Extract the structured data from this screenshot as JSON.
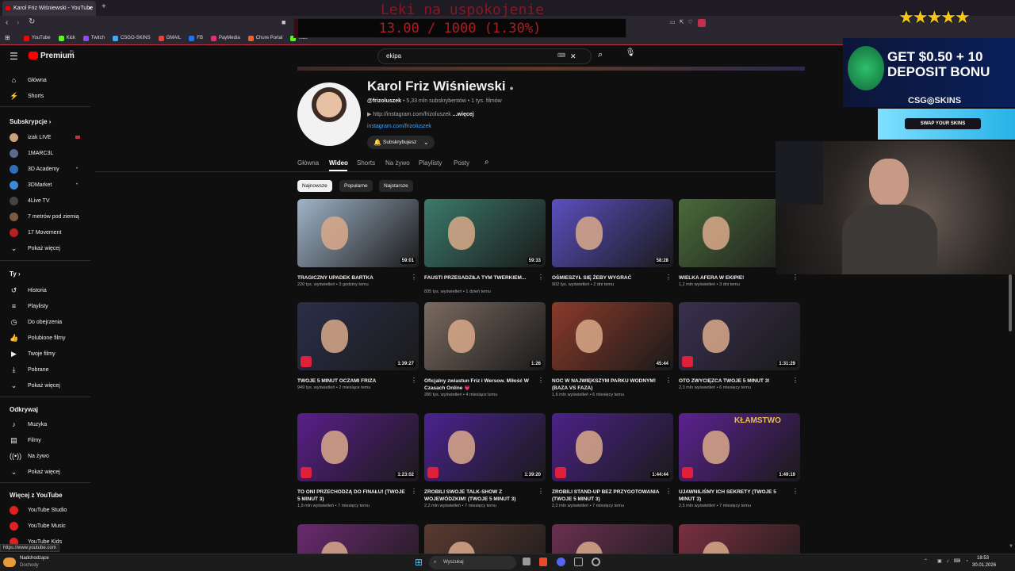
{
  "browser": {
    "tab_title": "Karol Friz Wiśniewski - YouTube",
    "new_tab": "+",
    "bookmarks": [
      {
        "label": "YouTube",
        "color": "#ff0000"
      },
      {
        "label": "Kick",
        "color": "#53fc18"
      },
      {
        "label": "Twitch",
        "color": "#9146ff"
      },
      {
        "label": "CSGO-SKINS",
        "color": "#3fa9f5"
      },
      {
        "label": "GMAIL",
        "color": "#ea4335"
      },
      {
        "label": "FB",
        "color": "#1877f2"
      },
      {
        "label": "PayMedia",
        "color": "#e1306c"
      },
      {
        "label": "Chure Portal",
        "color": "#ff5a1f"
      },
      {
        "label": "Kick",
        "color": "#53fc18"
      }
    ]
  },
  "overlay": {
    "goal_title": "Leki na uspokojenie",
    "goal_progress": "13.00 / 1000 (1.30%)",
    "goal_fraction": 0.013,
    "stars": "★★★★★",
    "ad_text": "GET $0.50 + 10\nDEPOSIT BONU",
    "ad_logo": "CSG◎SKINS",
    "ad_button": "SWAP YOUR SKINS"
  },
  "youtube": {
    "logo": "Premium",
    "logo_sup": "PL",
    "search_value": "ekipa",
    "sidebar": {
      "main": [
        {
          "label": "Główna",
          "icon": "home-icon"
        },
        {
          "label": "Shorts",
          "icon": "shorts-icon"
        }
      ],
      "subs_header": "Subskrypcje",
      "subs": [
        {
          "label": "izak LIVE",
          "color": "#c9a27a"
        },
        {
          "label": "1MARC3L",
          "color": "#5a6b8c"
        },
        {
          "label": "3D Academy",
          "color": "#2f6fb8"
        },
        {
          "label": "3DMarket",
          "color": "#3b8ad6"
        },
        {
          "label": "4Live TV",
          "color": "#444444"
        },
        {
          "label": "7 metrów pod ziemią",
          "color": "#7a5a40"
        },
        {
          "label": "17 Movement",
          "color": "#b82020"
        },
        {
          "label": "Pokaż więcej",
          "color": ""
        }
      ],
      "you_header": "Ty",
      "you": [
        {
          "label": "Historia",
          "icon": "history-icon"
        },
        {
          "label": "Playlisty",
          "icon": "playlist-icon"
        },
        {
          "label": "Do obejrzenia",
          "icon": "clock-icon"
        },
        {
          "label": "Polubione filmy",
          "icon": "like-icon"
        },
        {
          "label": "Twoje filmy",
          "icon": "video-icon"
        },
        {
          "label": "Pobrane",
          "icon": "download-icon"
        },
        {
          "label": "Pokaż więcej",
          "icon": "chevron-down-icon"
        }
      ],
      "explore_header": "Odkrywaj",
      "explore": [
        {
          "label": "Muzyka",
          "icon": "music-icon"
        },
        {
          "label": "Filmy",
          "icon": "film-icon"
        },
        {
          "label": "Na żywo",
          "icon": "live-icon"
        },
        {
          "label": "Pokaż więcej",
          "icon": "chevron-down-icon"
        }
      ],
      "more_header": "Więcej z YouTube",
      "more": [
        {
          "label": "YouTube Studio"
        },
        {
          "label": "YouTube Music"
        },
        {
          "label": "YouTube Kids"
        }
      ]
    },
    "channel": {
      "name": "Karol Friz Wiśniewski",
      "handle": "@frizoluszek",
      "stats": "• 5,33 mln subskrybentów • 1 tys. filmów",
      "link": "▶ http://instagram.com/frizoluszek",
      "more": "...więcej",
      "insta": "instagram.com/frizoluszek",
      "sub_button": "Subskrybujesz"
    },
    "tabs": [
      "Główna",
      "Wideo",
      "Shorts",
      "Na żywo",
      "Playlisty",
      "Posty"
    ],
    "active_tab": "Wideo",
    "chips": [
      "Najnowsze",
      "Popularne",
      "Najstarsze"
    ],
    "videos": [
      {
        "title": "TRAGICZNY UPADEK BARTKA",
        "meta": "220 tys. wyświetleń • 3 godziny temu",
        "dur": "59:01",
        "bg": "#9fb3c8"
      },
      {
        "title": "FAUSTI PRZESADZIŁA TYM TWERKIEM...",
        "meta": "835 tys. wyświetleń • 1 dzień temu",
        "dur": "59:33",
        "bg": "#3b7a6a"
      },
      {
        "title": "OŚMIESZYŁ SIĘ ŻEBY WYGRAĆ",
        "meta": "902 tys. wyświetleń • 2 dni temu",
        "dur": "58:28",
        "bg": "#5b4fbf"
      },
      {
        "title": "WIELKA AFERA W EKIPIE!",
        "meta": "1,2 mln wyświetleń • 3 dni temu",
        "dur": "",
        "bg": "#4a6a3a"
      },
      {
        "title": "TWOJE 5 MINUT OCZAMI FRIZA",
        "meta": "949 tys. wyświetleń • 2 miesiące temu",
        "dur": "1:39:27",
        "bg": "#2a2f4a"
      },
      {
        "title": "Oficjalny zwiastun Friz i Wersow. Miłość W Czasach Online 💗",
        "meta": "280 tys. wyświetleń • 4 miesiące temu",
        "dur": "1:26",
        "bg": "#7a6a60"
      },
      {
        "title": "NOC W NAJWIĘKSZYM PARKU WODNYM! (BAZA VS FAZA)",
        "meta": "1,6 mln wyświetleń • 6 miesięcy temu",
        "dur": "45:44",
        "bg": "#8a3a2a"
      },
      {
        "title": "OTO ZWYCIĘZCA TWOJE 5 MINUT 3!",
        "meta": "2,3 mln wyświetleń • 6 miesięcy temu",
        "dur": "1:31:29",
        "bg": "#3a3050"
      },
      {
        "title": "TO ONI PRZECHODZĄ DO FINAŁU! (TWOJE 5 MINUT 3)",
        "meta": "1,9 mln wyświetleń • 7 miesięcy temu",
        "dur": "1:23:02",
        "bg": "#5a1f8a"
      },
      {
        "title": "ZROBILI SWOJE TALK-SHOW Z WOJEWÓDZKIM! (TWOJE 5 MINUT 3)",
        "meta": "2,2 mln wyświetleń • 7 miesięcy temu",
        "dur": "1:39:20",
        "bg": "#4a2390"
      },
      {
        "title": "ZROBILI STAND-UP BEZ PRZYGOTOWANIA (TWOJE 5 MINUT 3)",
        "meta": "2,2 mln wyświetleń • 7 miesięcy temu",
        "dur": "1:44:44",
        "bg": "#4c2288"
      },
      {
        "title": "UJAWNILIŚMY ICH SEKRETY (TWOJE 5 MINUT 3)",
        "meta": "2,5 mln wyświetleń • 7 miesięcy temu",
        "dur": "1:49:19",
        "bg": "#5c2290",
        "badge": "KŁAMSTWO"
      },
      {
        "title": "",
        "meta": "",
        "dur": "",
        "bg": "#6a2a70"
      },
      {
        "title": "",
        "meta": "",
        "dur": "",
        "bg": "#5a3a30"
      },
      {
        "title": "",
        "meta": "",
        "dur": "",
        "bg": "#6a3050"
      },
      {
        "title": "",
        "meta": "",
        "dur": "",
        "bg": "#7a3040"
      }
    ],
    "status_url": "https://www.youtube.com"
  },
  "taskbar": {
    "weather_line1": "Nadchodzące",
    "weather_line2": "Dochody",
    "search_placeholder": "Wyszukaj",
    "time": "18:53",
    "date": "30.01.2026"
  }
}
